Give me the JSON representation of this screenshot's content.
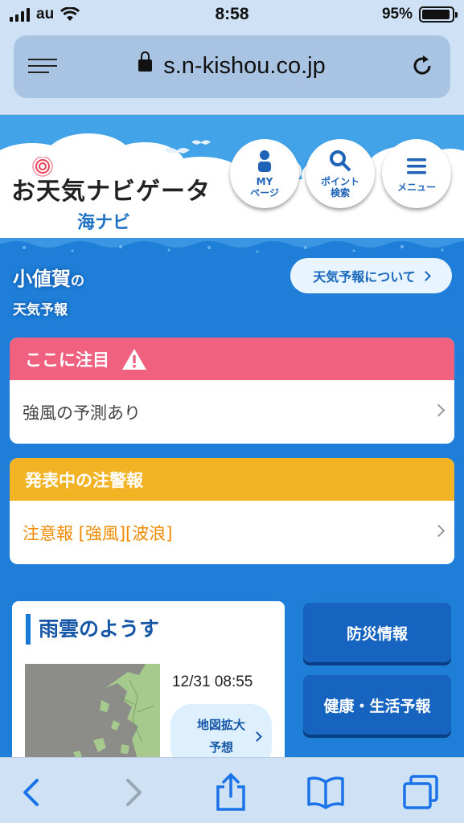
{
  "status_bar": {
    "carrier": "au",
    "time": "8:58",
    "battery": "95%",
    "battery_level": 0.95
  },
  "browser": {
    "url": "s.n-kishou.co.jp"
  },
  "header": {
    "logo_main": "お天気ナビゲータ",
    "logo_sub": "海ナビ",
    "buttons": [
      {
        "label": "MY\nページ",
        "icon": "person-icon"
      },
      {
        "label": "ポイント\n検索",
        "icon": "search-icon"
      },
      {
        "label": "メニュー",
        "icon": "hamburger-icon"
      }
    ]
  },
  "location": {
    "name": "小値賀",
    "particle": "の",
    "subtitle": "天気予報",
    "about_label": "天気予報について"
  },
  "attention": {
    "title": "ここに注目",
    "item": "強風の予測あり",
    "color": "#f0607f"
  },
  "warnings": {
    "title": "発表中の注警報",
    "item": "注意報 [強風][波浪]",
    "color": "#f2b425",
    "text_color": "#f08a00"
  },
  "rain": {
    "title": "雨雲のようす",
    "time": "12/31 08:55",
    "button": "地図拡大\n予想"
  },
  "side_buttons": {
    "disaster": "防災情報",
    "health": "健康・生活予報"
  },
  "colors": {
    "page_bg": "#1f7fd8",
    "header_sky": "#43a3e8",
    "button_blue": "#1664c0"
  }
}
